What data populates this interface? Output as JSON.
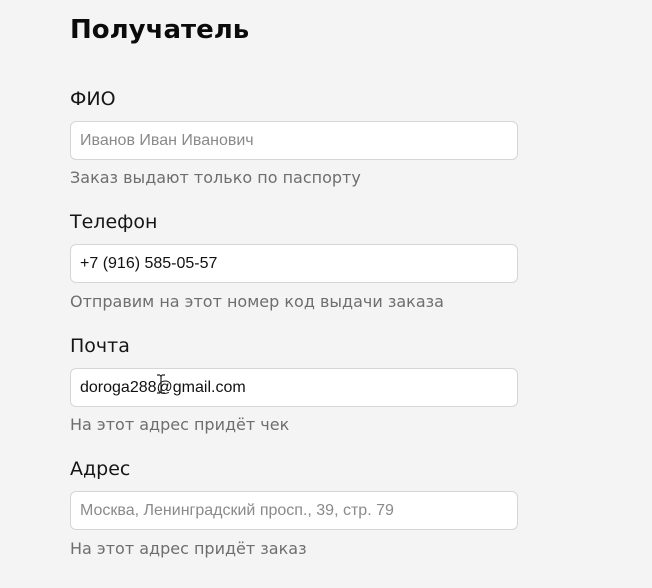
{
  "section": {
    "title": "Получатель"
  },
  "fields": [
    {
      "label": "ФИО",
      "value": "",
      "placeholder": "Иванов Иван Иванович",
      "hint": "Заказ выдают только по паспорту"
    },
    {
      "label": "Телефон",
      "value": "+7 (916) 585-05-57",
      "placeholder": "",
      "hint": "Отправим на этот номер код выдачи заказа"
    },
    {
      "label": "Почта",
      "value": "doroga288@gmail.com",
      "placeholder": "",
      "hint": "На этот адрес придёт чек"
    },
    {
      "label": "Адрес",
      "value": "",
      "placeholder": "Москва, Ленинградский просп., 39, стр. 79",
      "hint": "На этот адрес придёт заказ"
    }
  ],
  "pointer": {
    "icon": "text-cursor-icon"
  }
}
